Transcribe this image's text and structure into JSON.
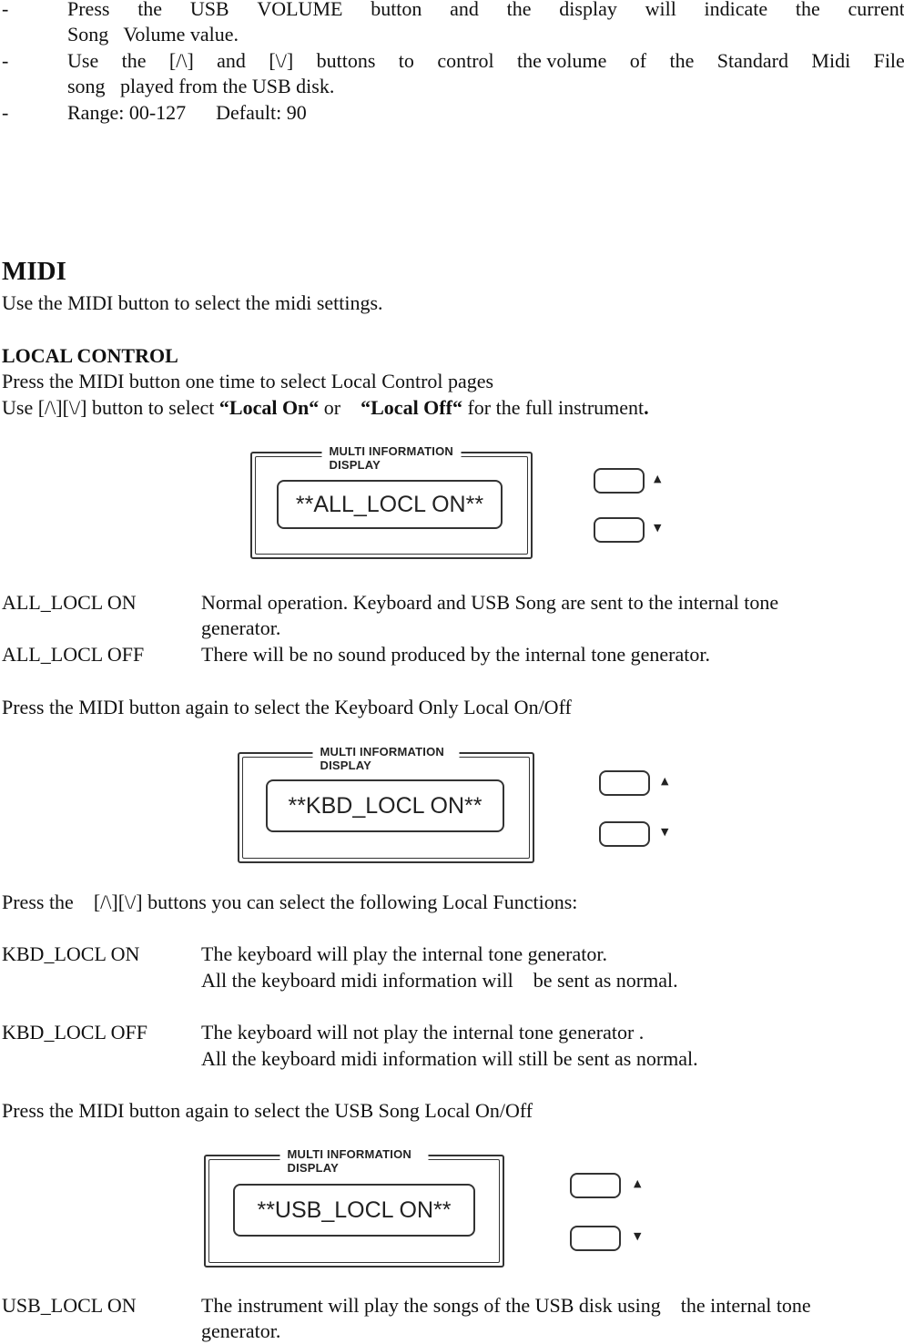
{
  "volume_bullets": [
    {
      "dash": "-",
      "line1": [
        "Press",
        "the",
        "USB",
        "VOLUME",
        "button",
        "and",
        "the",
        "display",
        "will",
        "indicate",
        "the",
        "current"
      ],
      "line2": "Song   Volume value."
    },
    {
      "dash": "-",
      "line1": [
        "Use",
        "the",
        "[/\\]",
        "and",
        "[\\/]",
        "buttons",
        "to",
        "control",
        "the volume",
        "of",
        "the",
        "Standard",
        "Midi",
        "File"
      ],
      "line2": "song   played from the USB disk."
    },
    {
      "dash": "-",
      "text": "Range: 00-127      Default: 90"
    }
  ],
  "midi": {
    "heading": "MIDI",
    "intro": "Use the MIDI button to select the midi settings.",
    "local_control": {
      "heading": "LOCAL CONTROL",
      "line1": "Press the MIDI button one time to select Local Control pages",
      "line2_pre": "Use [/\\][\\/] button to select ",
      "line2_on": "“Local On“",
      "line2_or": " or    ",
      "line2_off": "“Local Off“",
      "line2_post": " for the full instrument",
      "line2_period": "."
    },
    "displays": [
      {
        "label": "MULTI INFORMATION DISPLAY",
        "lcd_text": "**ALL_LOCL ON**",
        "up_icon": "▲",
        "down_icon": "▼"
      },
      {
        "label": "MULTI INFORMATION DISPLAY",
        "lcd_text": "**KBD_LOCL ON**",
        "up_icon": "▲",
        "down_icon": "▼"
      },
      {
        "label": "MULTI INFORMATION DISPLAY",
        "lcd_text": "**USB_LOCL ON**",
        "up_icon": "▲",
        "down_icon": "▼"
      }
    ],
    "all_local": [
      {
        "term": "ALL_LOCL ON",
        "desc1": "Normal operation. Keyboard and USB Song are sent to the internal tone",
        "desc2": "generator."
      },
      {
        "term": "ALL_LOCL OFF",
        "desc1": "There will be no sound produced by the internal tone generator."
      }
    ],
    "kbd_intro": "Press the MIDI button again to select the Keyboard Only Local On/Off",
    "functions_intro": "Press the    [/\\][\\/] buttons you can select the following Local Functions:",
    "kbd_local": [
      {
        "term": "KBD_LOCL ON",
        "desc1": "The keyboard will play the internal tone generator.",
        "desc2": "All the keyboard midi information will    be sent as normal."
      },
      {
        "term": "KBD_LOCL OFF",
        "desc1": "The keyboard will not play the internal tone generator .",
        "desc2": "All the keyboard midi information will still be sent as normal."
      }
    ],
    "usb_intro": "Press the MIDI button again to select the USB Song Local On/Off",
    "usb_local": [
      {
        "term": "USB_LOCL ON",
        "desc1": "The instrument will play the songs of the USB disk using    the internal tone",
        "desc2": "generator."
      }
    ]
  }
}
